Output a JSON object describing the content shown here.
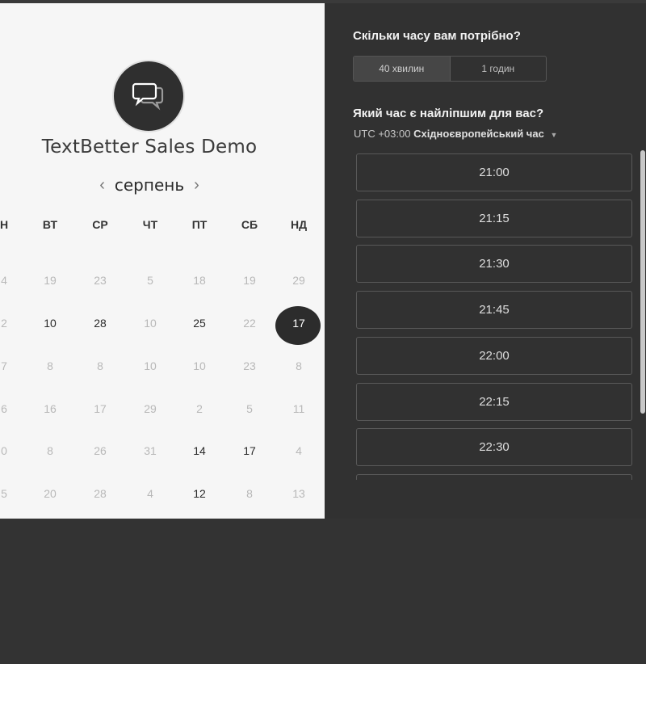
{
  "calendar": {
    "event_title": "TextBetter Sales Demo",
    "month": "серпень",
    "prev_arrow": "‹",
    "next_arrow": "›",
    "weekdays": [
      "Н",
      "ВТ",
      "СР",
      "ЧТ",
      "ПТ",
      "СБ",
      "НД"
    ],
    "weeks": [
      [
        {
          "d": "4",
          "a": false
        },
        {
          "d": "19",
          "a": false
        },
        {
          "d": "23",
          "a": false
        },
        {
          "d": "5",
          "a": false
        },
        {
          "d": "18",
          "a": false
        },
        {
          "d": "19",
          "a": false
        },
        {
          "d": "29",
          "a": false
        }
      ],
      [
        {
          "d": "2",
          "a": false
        },
        {
          "d": "10",
          "a": true
        },
        {
          "d": "28",
          "a": true
        },
        {
          "d": "10",
          "a": false
        },
        {
          "d": "25",
          "a": true
        },
        {
          "d": "22",
          "a": false
        },
        {
          "d": "17",
          "a": true,
          "selected": true
        }
      ],
      [
        {
          "d": "7",
          "a": false
        },
        {
          "d": "8",
          "a": false
        },
        {
          "d": "8",
          "a": false
        },
        {
          "d": "10",
          "a": false
        },
        {
          "d": "10",
          "a": false
        },
        {
          "d": "23",
          "a": false
        },
        {
          "d": "8",
          "a": false
        }
      ],
      [
        {
          "d": "6",
          "a": false
        },
        {
          "d": "16",
          "a": false
        },
        {
          "d": "17",
          "a": false
        },
        {
          "d": "29",
          "a": false
        },
        {
          "d": "2",
          "a": false
        },
        {
          "d": "5",
          "a": false
        },
        {
          "d": "11",
          "a": false
        }
      ],
      [
        {
          "d": "0",
          "a": false
        },
        {
          "d": "8",
          "a": false
        },
        {
          "d": "26",
          "a": false
        },
        {
          "d": "31",
          "a": false
        },
        {
          "d": "14",
          "a": true
        },
        {
          "d": "17",
          "a": true
        },
        {
          "d": "4",
          "a": false
        }
      ],
      [
        {
          "d": "5",
          "a": false
        },
        {
          "d": "20",
          "a": false
        },
        {
          "d": "28",
          "a": false
        },
        {
          "d": "4",
          "a": false
        },
        {
          "d": "12",
          "a": true
        },
        {
          "d": "8",
          "a": false
        },
        {
          "d": "13",
          "a": false
        }
      ]
    ]
  },
  "booking": {
    "duration_question": "Скільки часу вам потрібно?",
    "durations": [
      "40 хвилин",
      "1 годин"
    ],
    "time_question": "Який час є найліпшим для вас?",
    "timezone_offset": "UTC +03:00",
    "timezone_name": "Східноєвропейський час",
    "slots": [
      "21:00",
      "21:15",
      "21:30",
      "21:45",
      "22:00",
      "22:15",
      "22:30",
      ""
    ]
  },
  "colors": {
    "panel_dark": "#313131",
    "panel_light": "#f6f6f6",
    "selected_day": "#2c2c2c"
  },
  "icons": {
    "logo": "chat-bubbles-icon",
    "timezone_caret": "caret-down-icon"
  }
}
